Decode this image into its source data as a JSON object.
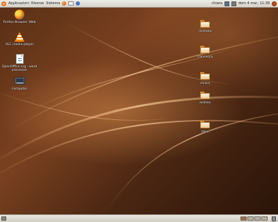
{
  "top_panel": {
    "menus": [
      "Applicazioni",
      "Risorse",
      "Sistema"
    ],
    "user_name": "chiara",
    "clock": "dom 4 mar, 11:38"
  },
  "desktop": {
    "left_icons": [
      {
        "label": "Firefox Browser Web",
        "icon": "firefox-icon"
      },
      {
        "label": "VLC media player",
        "icon": "vlc-icon"
      },
      {
        "label": "OpenOffice.org - word processor",
        "icon": "document-icon"
      },
      {
        "label": "computer",
        "icon": "computer-icon"
      }
    ],
    "folders": [
      {
        "label": "michela"
      },
      {
        "label": "francesca"
      },
      {
        "label": "chiara"
      },
      {
        "label": "andrea"
      },
      {
        "label": "libro"
      }
    ]
  },
  "colors": {
    "wallpaper_base": "#5a2f15",
    "panel": "#e2e0d8",
    "folder": "#e9c99a"
  }
}
